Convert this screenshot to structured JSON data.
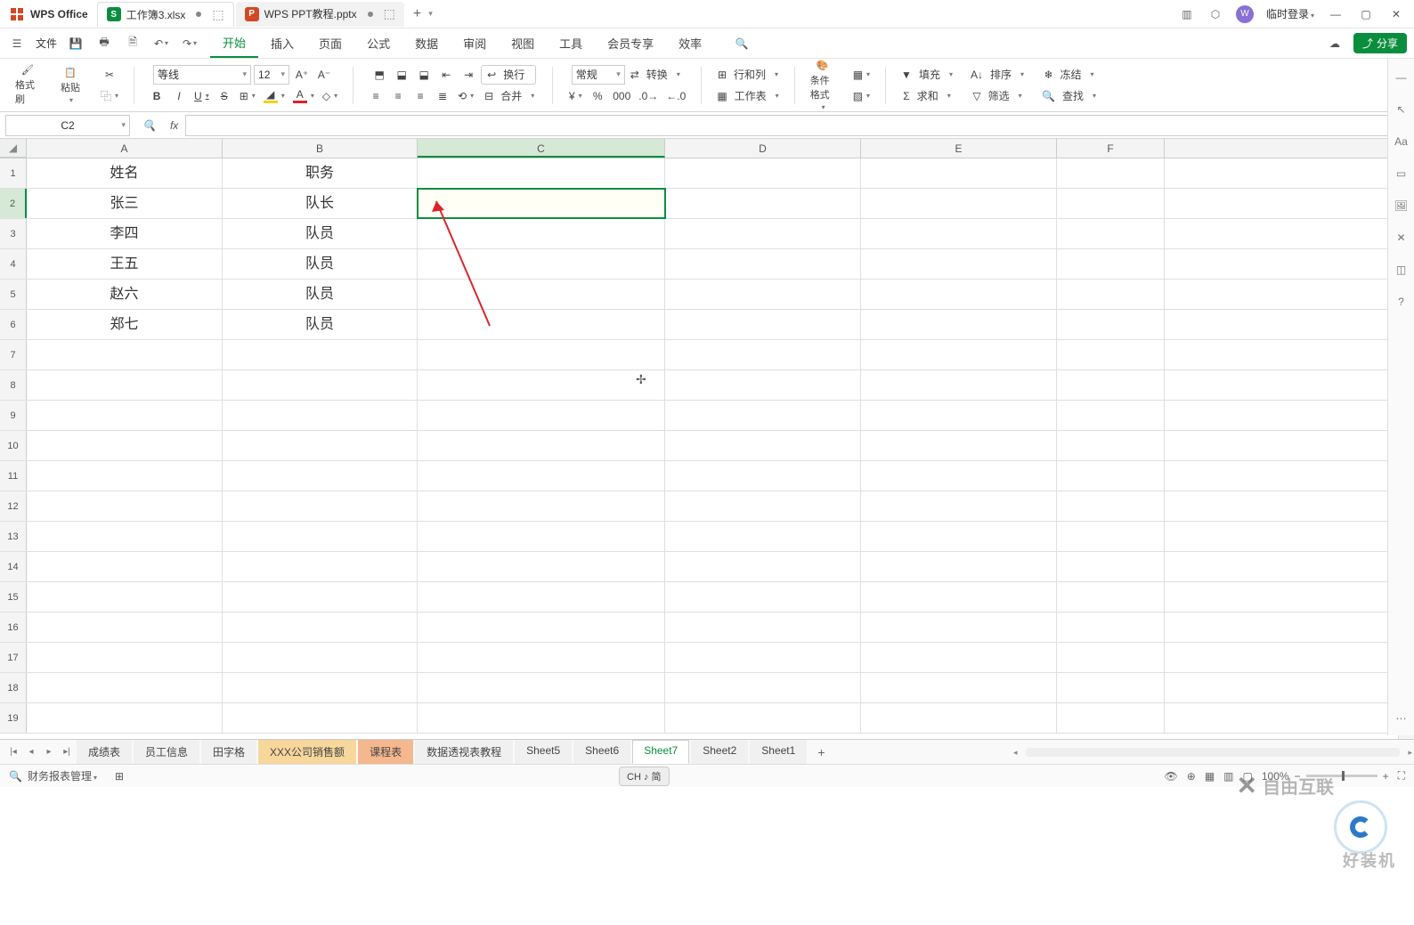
{
  "app": {
    "name": "WPS Office"
  },
  "tabs": [
    {
      "label": "工作簿3.xlsx",
      "icon": "S",
      "iconColor": "green",
      "active": true
    },
    {
      "label": "WPS PPT教程.pptx",
      "icon": "P",
      "iconColor": "orange",
      "active": false
    }
  ],
  "title_right": {
    "login": "临时登录"
  },
  "menu": {
    "file": "文件",
    "items": [
      "开始",
      "插入",
      "页面",
      "公式",
      "数据",
      "审阅",
      "视图",
      "工具",
      "会员专享",
      "效率"
    ],
    "active": "开始"
  },
  "share_btn": "分享",
  "ribbon": {
    "format_painter": "格式刷",
    "paste": "粘贴",
    "font_name": "等线",
    "font_size": "12",
    "bold": "B",
    "italic": "I",
    "underline": "U",
    "strike": "S",
    "wrap": "换行",
    "merge": "合并",
    "number_format": "常规",
    "convert": "转换",
    "rowcol": "行和列",
    "worksheet": "工作表",
    "cond_fmt": "条件格式",
    "fill": "填充",
    "sort": "排序",
    "freeze": "冻结",
    "sum": "求和",
    "filter": "筛选",
    "find": "查找"
  },
  "namebox": "C2",
  "formula": "",
  "columns": [
    "A",
    "B",
    "C",
    "D",
    "E",
    "F"
  ],
  "selected_col": "C",
  "selected_row": 2,
  "row_count": 19,
  "cells": {
    "A1": "姓名",
    "B1": "职务",
    "A2": "张三",
    "B2": "队长",
    "A3": "李四",
    "B3": "队员",
    "A4": "王五",
    "B4": "队员",
    "A5": "赵六",
    "B5": "队员",
    "A6": "郑七",
    "B6": "队员"
  },
  "sheet_nav": [
    "成绩表",
    "员工信息",
    "田字格",
    "XXX公司销售额",
    "课程表",
    "数据透视表教程",
    "Sheet5",
    "Sheet6",
    "Sheet7",
    "Sheet2",
    "Sheet1"
  ],
  "sheet_highlight": {
    "XXX公司销售额": "hl1",
    "课程表": "hl2"
  },
  "active_sheet": "Sheet7",
  "status": {
    "doc_mgmt": "财务报表管理",
    "ime": "CH ♪ 简",
    "zoom": "100%"
  },
  "watermark1": "自由互联",
  "watermark2": "好装机"
}
